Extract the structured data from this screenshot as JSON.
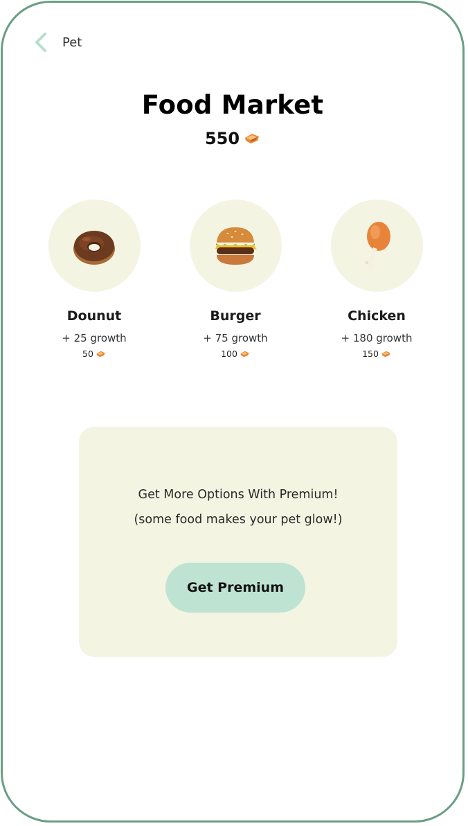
{
  "nav": {
    "back_icon": "chevron-left-icon",
    "title": "Pet",
    "accent_color": "#b5dfcb"
  },
  "market": {
    "title": "Food Market",
    "balance": "550",
    "currency_icon": "treat-coin-icon"
  },
  "items": [
    {
      "name": "Dounut",
      "growth": "+ 25 growth",
      "price": "50",
      "icon": "donut-icon"
    },
    {
      "name": "Burger",
      "growth": "+ 75 growth",
      "price": "100",
      "icon": "burger-icon"
    },
    {
      "name": "Chicken",
      "growth": "+ 180 growth",
      "price": "150",
      "icon": "chicken-leg-icon"
    }
  ],
  "promo": {
    "line1": "Get More Options With Premium!",
    "line2": "(some food makes your pet glow!)",
    "button_label": "Get Premium",
    "button_color": "#bee3d2",
    "card_color": "#f4f4e3"
  },
  "frame": {
    "border_color": "#6a9e84"
  }
}
